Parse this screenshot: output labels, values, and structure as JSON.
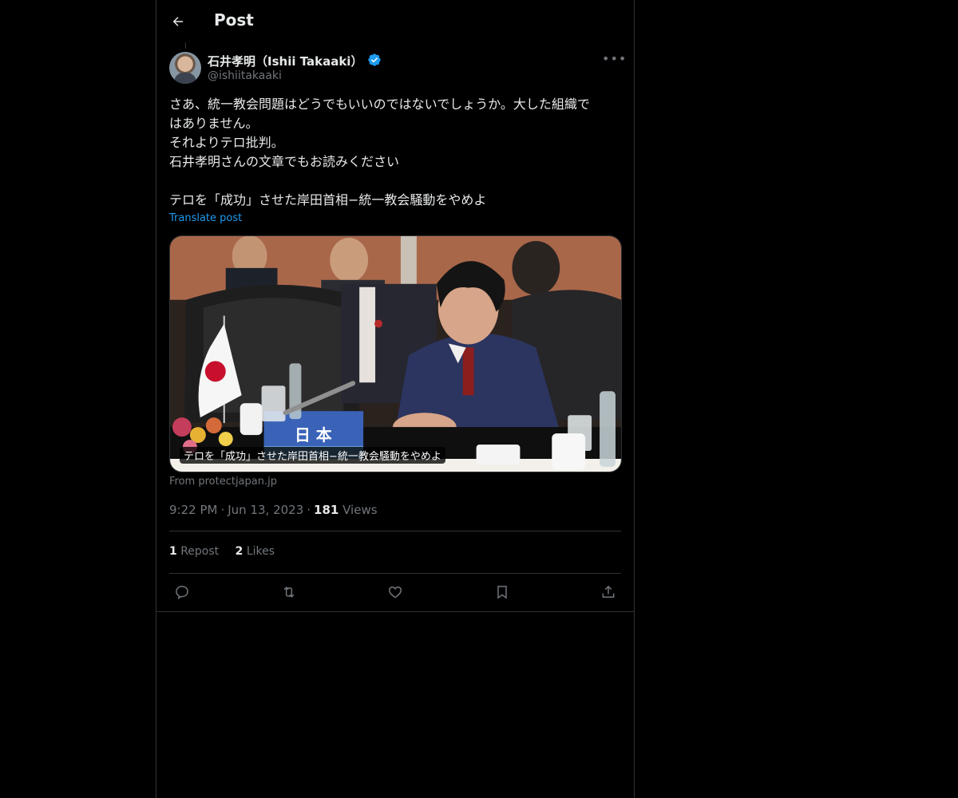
{
  "header": {
    "title": "Post",
    "back_icon": "arrow-left-icon"
  },
  "author": {
    "name": "石井孝明（Ishii Takaaki）",
    "handle": "@ishiitakaaki",
    "verified": true,
    "verified_color": "#1d9bf0"
  },
  "post": {
    "lines": [
      "さあ、統一教会問題はどうでもいいのではないでしょうか。大した組織で",
      "はありません。",
      "それよりテロ批判。",
      "石井孝明さんの文章でもお読みください",
      "",
      "テロを「成功」させた岸田首相−統一教会騒動をやめよ"
    ],
    "translate_label": "Translate post"
  },
  "card": {
    "caption": "テロを「成功」させた岸田首相−統一教会騒動をやめよ",
    "placard_text": "日 本",
    "source": "From protectjapan.jp"
  },
  "meta": {
    "time": "9:22 PM",
    "date": "Jun 13, 2023",
    "views_count": "181",
    "views_label": "Views"
  },
  "stats": {
    "reposts_count": "1",
    "reposts_label": "Repost",
    "likes_count": "2",
    "likes_label": "Likes"
  },
  "actions": [
    "reply-icon",
    "repost-icon",
    "like-icon",
    "bookmark-icon",
    "share-icon"
  ],
  "colors": {
    "background": "#000000",
    "text": "#e7e9ea",
    "muted": "#71767b",
    "accent": "#1d9bf0",
    "border": "#2f3336"
  }
}
